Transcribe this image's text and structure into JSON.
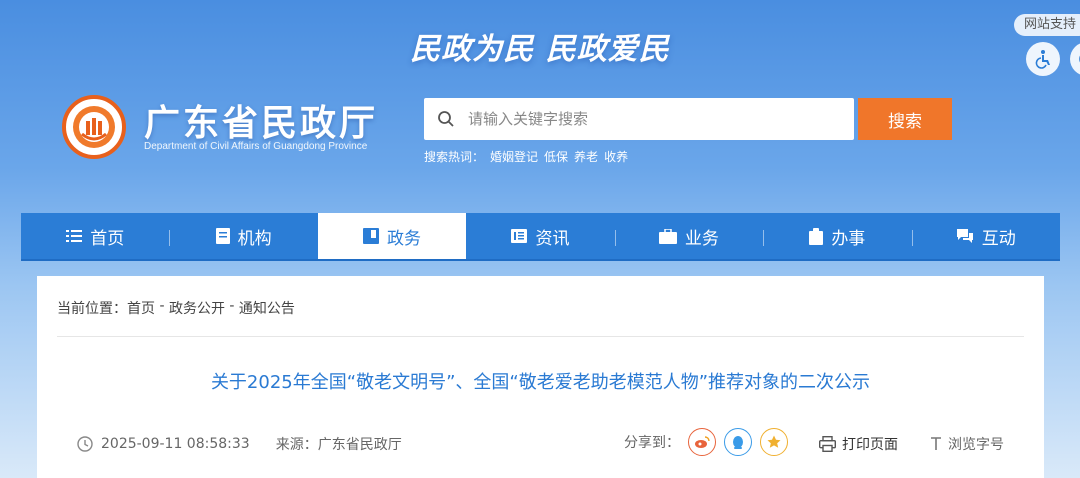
{
  "header": {
    "slogan": "民政为民  民政爱民",
    "site_support": "网站支持",
    "logo_title": "广东省民政厅",
    "logo_subtitle": "Department of Civil Affairs of Guangdong Province"
  },
  "search": {
    "placeholder": "请输入关键字搜索",
    "button_label": "搜索",
    "hot_label": "搜索热词：",
    "hot_words": [
      "婚姻登记",
      "低保",
      "养老",
      "收养"
    ]
  },
  "nav": {
    "items": [
      {
        "label": "首页",
        "icon": "list-icon"
      },
      {
        "label": "机构",
        "icon": "document-icon"
      },
      {
        "label": "政务",
        "icon": "book-icon"
      },
      {
        "label": "资讯",
        "icon": "news-icon"
      },
      {
        "label": "业务",
        "icon": "briefcase-icon"
      },
      {
        "label": "办事",
        "icon": "clipboard-icon"
      },
      {
        "label": "互动",
        "icon": "chat-icon"
      }
    ],
    "active": "政务"
  },
  "breadcrumb": {
    "label": "当前位置：",
    "path": [
      "首页",
      "政务公开",
      "通知公告"
    ],
    "separator": " - "
  },
  "article": {
    "title": "关于2025年全国“敬老文明号”、全国“敬老爱老助老模范人物”推荐对象的二次公示",
    "datetime": "2025-09-11 08:58:33",
    "source_label": "来源：",
    "source": "广东省民政厅",
    "share_label": "分享到：",
    "print_label": "打印页面",
    "font_label": "浏览字号"
  },
  "colors": {
    "nav_bg": "#2b7dd6",
    "accent_orange": "#f0762a",
    "title_blue": "#2a7ad3"
  }
}
